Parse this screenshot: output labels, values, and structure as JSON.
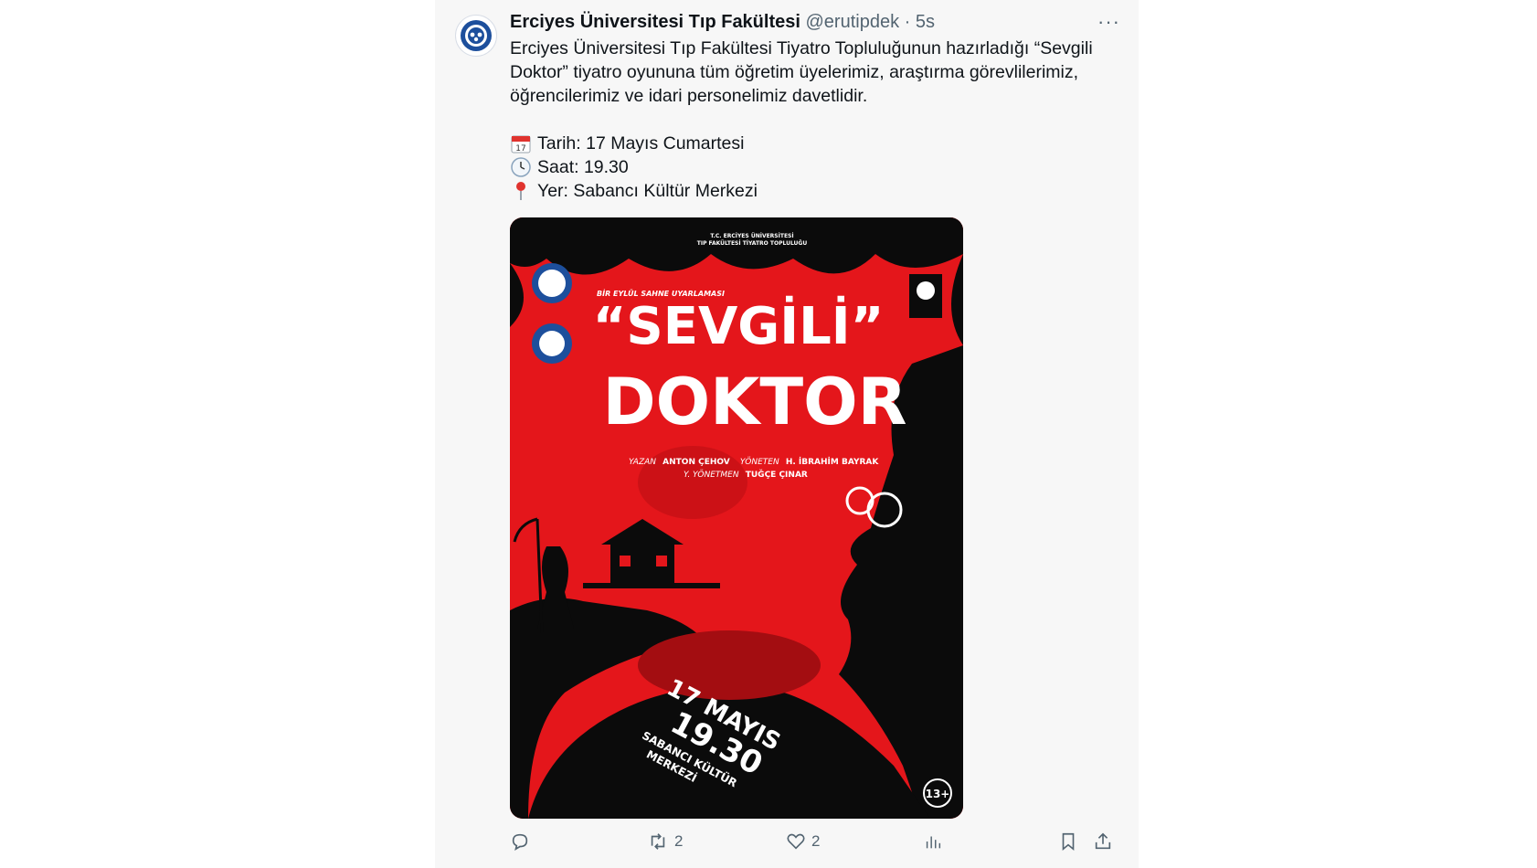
{
  "tweet": {
    "author_name": "Erciyes Üniversitesi Tıp Fakültesi",
    "author_handle": "@erutipdek",
    "separator": "·",
    "time": "5s",
    "more_label": "···",
    "text": "Erciyes Üniversitesi Tıp Fakültesi Tiyatro Topluluğunun hazırladığı “Sevgili Doktor” tiyatro oyununa tüm öğretim üyelerimiz, araştırma görevlilerimiz, öğrencilerimiz ve idari personelimiz davetlidir.",
    "details": [
      {
        "icon": "calendar-icon",
        "text": "Tarih: 17 Mayıs Cumartesi"
      },
      {
        "icon": "clock-icon",
        "text": "Saat: 19.30"
      },
      {
        "icon": "pin-icon",
        "text": "Yer: Sabancı Kültür Merkezi"
      }
    ]
  },
  "poster": {
    "org_line1": "T.C. ERCİYES ÜNİVERSİTESİ",
    "org_line2": "TIP FAKÜLTESİ TİYATRO TOPLULUĞU",
    "tagline": "BİR EYLÜL SAHNE UYARLAMASI",
    "title_1": "“SEVGİLİ”",
    "title_2": "DOKTOR",
    "writer_label": "YAZAN",
    "writer": "ANTON ÇEHOV",
    "director_label": "YÖNETEN",
    "director": "H. İBRAHİM BAYRAK",
    "asst_label": "Y. YÖNETMEN",
    "asst": "TUĞÇE ÇINAR",
    "date_line": "17 MAYIS",
    "time_line": "19.30",
    "venue_line1": "SABANCI KÜLTÜR",
    "venue_line2": "MERKEZİ",
    "age_rating": "13+",
    "colors": {
      "red": "#e4161b",
      "dark": "#0b0b0b"
    }
  },
  "actions": {
    "reply_count": "",
    "retweet_count": "2",
    "like_count": "2"
  }
}
